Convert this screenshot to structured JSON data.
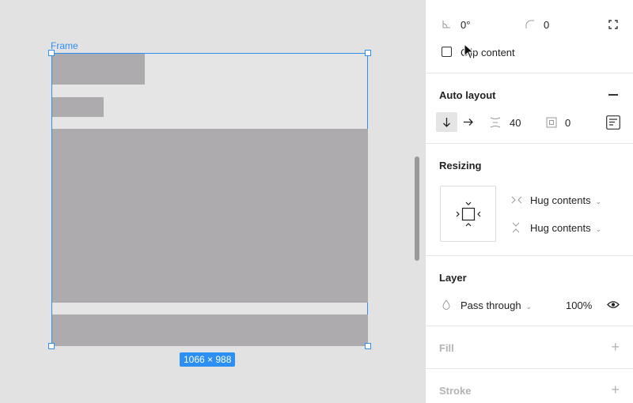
{
  "canvas": {
    "frame_label": "Frame",
    "size_badge": "1066 × 988"
  },
  "panel": {
    "top": {
      "rotation": "0°",
      "corner_radius": "0",
      "clip_content_label": "Clip content"
    },
    "auto_layout": {
      "title": "Auto layout",
      "spacing": "40",
      "padding": "0"
    },
    "resizing": {
      "title": "Resizing",
      "horizontal": "Hug contents",
      "vertical": "Hug contents"
    },
    "layer": {
      "title": "Layer",
      "blend_mode": "Pass through",
      "opacity": "100%"
    },
    "fill": {
      "title": "Fill"
    },
    "stroke": {
      "title": "Stroke"
    }
  },
  "colors": {
    "selection": "#2b8ff3",
    "placeholder": "#adabad"
  }
}
